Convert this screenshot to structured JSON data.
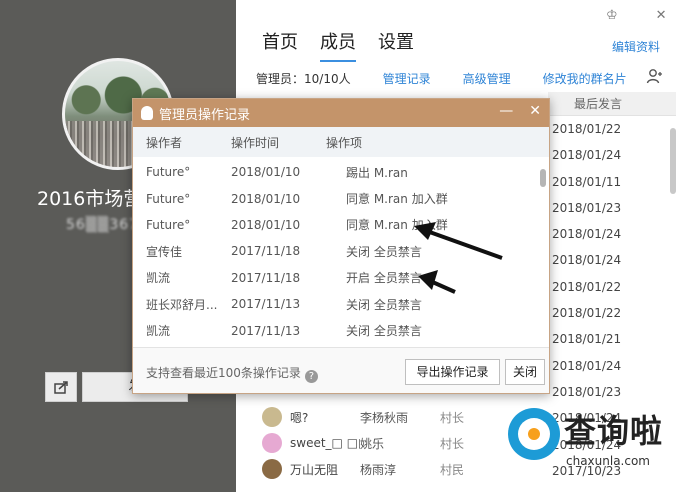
{
  "group": {
    "name": "2016市场营",
    "id_blurred": "56▒▒3674"
  },
  "left_buttons": {
    "send_label": "发"
  },
  "tabs": [
    {
      "label": "首页"
    },
    {
      "label": "成员"
    },
    {
      "label": "设置"
    }
  ],
  "header": {
    "edit_label": "编辑资料",
    "admin_count": "管理员：10/10人",
    "links": [
      "管理记录",
      "高级管理",
      "修改我的群名片"
    ],
    "last_speak_header": "最后发言"
  },
  "last_speak_dates": [
    "2018/01/22",
    "2018/01/24",
    "2018/01/11",
    "2018/01/23",
    "2018/01/24",
    "2018/01/24",
    "2018/01/22",
    "2018/01/22",
    "2018/01/21",
    "2018/01/24",
    "2018/01/23",
    "2018/01/24",
    "2018/01/24",
    "2017/10/23"
  ],
  "members": [
    {
      "nick": "嗯?",
      "card": "李杨秋雨",
      "role": "村长",
      "color": "#c9b98f"
    },
    {
      "nick": "sweet_□ □□",
      "card": "姚乐",
      "role": "村长",
      "color": "#e6a9d2"
    },
    {
      "nick": "万山无阻",
      "card": "杨雨淳",
      "role": "村民",
      "color": "#8a6a44"
    }
  ],
  "dialog": {
    "title": "管理员操作记录",
    "columns": [
      "操作者",
      "操作时间",
      "操作项"
    ],
    "rows": [
      {
        "operator": "Future°",
        "time": "2018/01/10",
        "action": "踢出 M.ran"
      },
      {
        "operator": "Future°",
        "time": "2018/01/10",
        "action": "同意 M.ran 加入群"
      },
      {
        "operator": "Future°",
        "time": "2018/01/10",
        "action": "同意 M.ran 加入群"
      },
      {
        "operator": "宣传佳",
        "time": "2017/11/18",
        "action": "关闭 全员禁言"
      },
      {
        "operator": "凯流",
        "time": "2017/11/18",
        "action": "开启 全员禁言"
      },
      {
        "operator": "班长邓舒月...",
        "time": "2017/11/13",
        "action": "关闭 全员禁言"
      },
      {
        "operator": "凯流",
        "time": "2017/11/13",
        "action": "关闭 全员禁言"
      }
    ],
    "footer_note": "支持查看最近100条操作记录",
    "export_label": "导出操作记录",
    "close_label": "关闭"
  },
  "watermark": {
    "title": "查询啦",
    "url": "chaxunla.com"
  },
  "colors": {
    "accent": "#2f84d6",
    "dialog_title": "#c4946a",
    "left_panel": "#5b5b58"
  }
}
